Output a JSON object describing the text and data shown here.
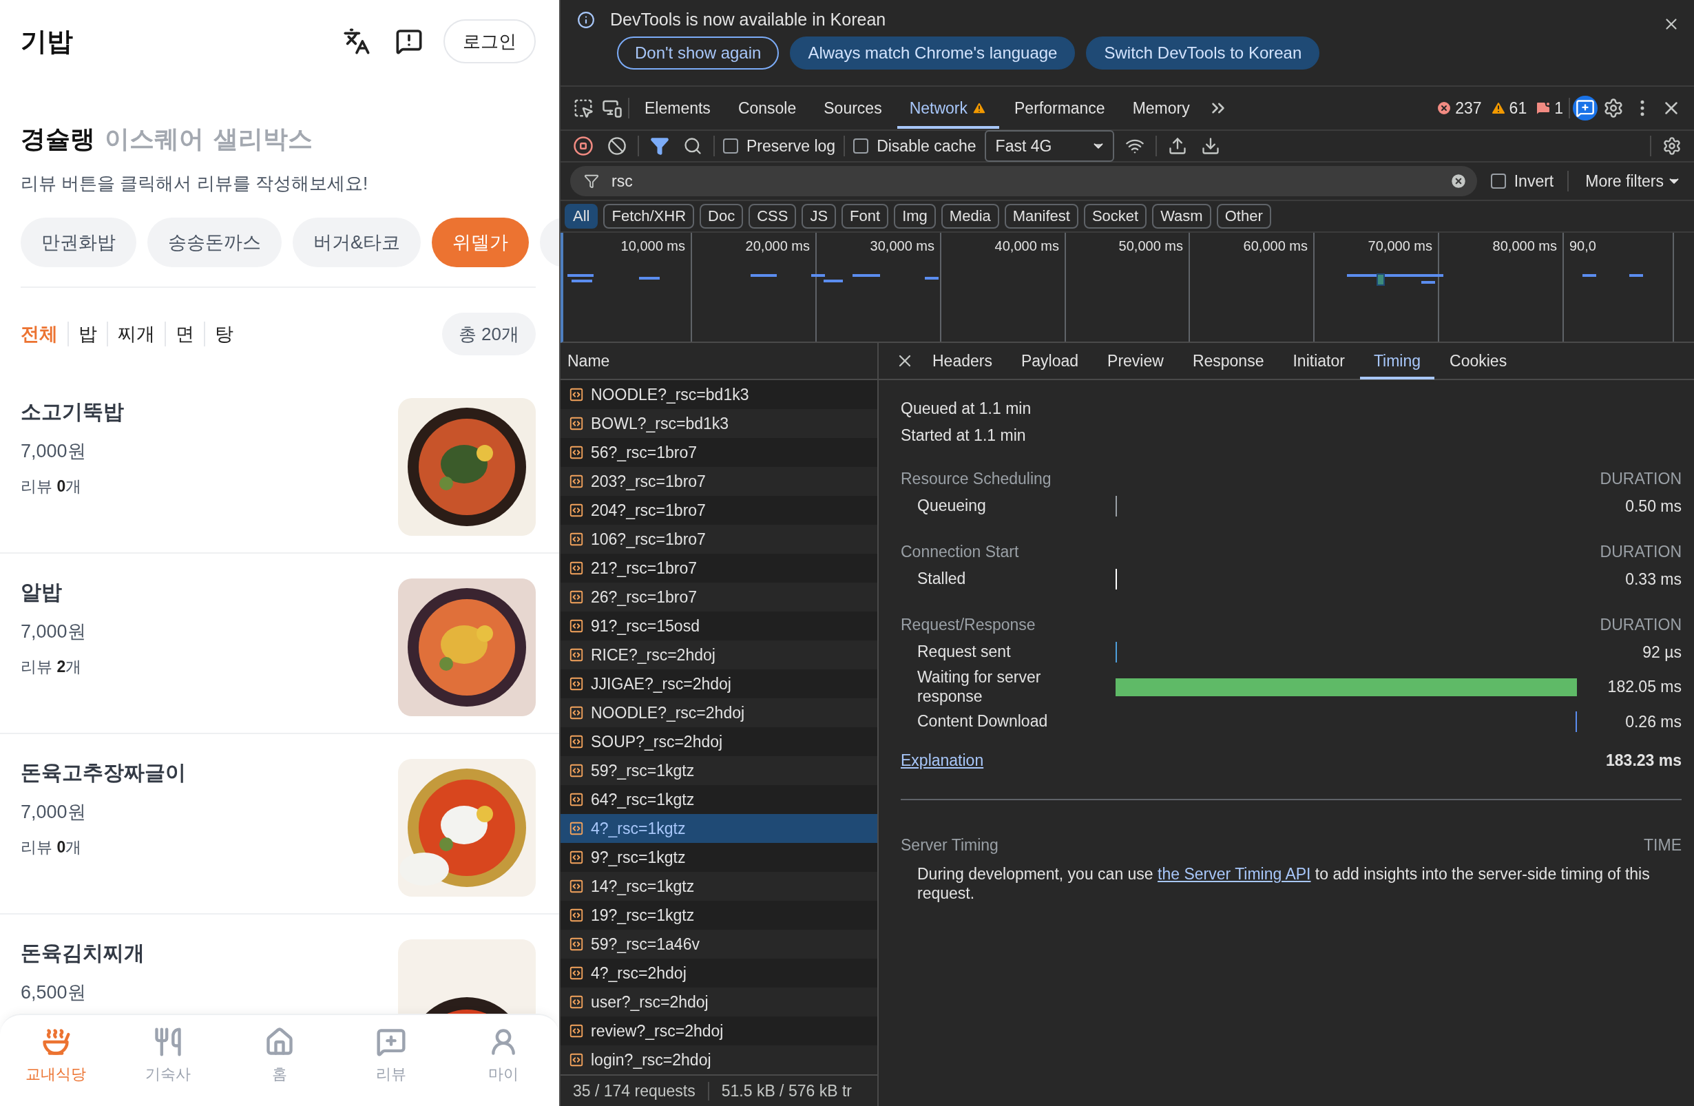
{
  "app": {
    "logo": "기밥",
    "login": "로그인",
    "title": "경슐랭",
    "title_tabs": [
      "이스퀘어",
      "샐리박스"
    ],
    "subtitle": "리뷰 버튼을 클릭해서 리뷰를 작성해보세요!",
    "chips": [
      {
        "label": "만권화밥",
        "selected": false
      },
      {
        "label": "송송돈까스",
        "selected": false
      },
      {
        "label": "버거&타코",
        "selected": false
      },
      {
        "label": "위델가",
        "selected": true
      }
    ],
    "categories": [
      {
        "label": "전체",
        "selected": true
      },
      {
        "label": "밥",
        "selected": false
      },
      {
        "label": "찌개",
        "selected": false
      },
      {
        "label": "면",
        "selected": false
      },
      {
        "label": "탕",
        "selected": false
      }
    ],
    "count": "총 20개",
    "menu": [
      {
        "name": "소고기뚝밥",
        "price": "7,000원",
        "reviews": "리뷰 **0**개"
      },
      {
        "name": "알밥",
        "price": "7,000원",
        "reviews": "리뷰 **2**개"
      },
      {
        "name": "돈육고추장짜글이",
        "price": "7,000원",
        "reviews": "리뷰 **0**개"
      },
      {
        "name": "돈육김치찌개",
        "price": "6,500원"
      }
    ],
    "nav": [
      {
        "label": "교내식당",
        "selected": true
      },
      {
        "label": "기숙사",
        "selected": false
      },
      {
        "label": "홈",
        "selected": false
      },
      {
        "label": "리뷰",
        "selected": false
      },
      {
        "label": "마이",
        "selected": false
      }
    ]
  },
  "devtools": {
    "infobar": {
      "message": "DevTools is now available in Korean",
      "buttons": [
        {
          "label": "Don't show again",
          "kind": "outline"
        },
        {
          "label": "Always match Chrome's language",
          "kind": "filled"
        },
        {
          "label": "Switch DevTools to Korean",
          "kind": "filled"
        }
      ]
    },
    "tabs": [
      {
        "label": "Elements",
        "selected": false
      },
      {
        "label": "Console",
        "selected": false
      },
      {
        "label": "Sources",
        "selected": false
      },
      {
        "label": "Network",
        "selected": true
      },
      {
        "label": "Performance",
        "selected": false
      },
      {
        "label": "Memory",
        "selected": false
      }
    ],
    "counts": {
      "errors": "237",
      "warnings": "61",
      "issues": "1"
    },
    "toolbar": {
      "preserve_log": {
        "label": "Preserve log",
        "checked": false
      },
      "disable_cache": {
        "label": "Disable cache",
        "checked": false
      },
      "throttle": "Fast 4G"
    },
    "filter": {
      "value": "rsc",
      "invert": {
        "label": "Invert",
        "checked": false
      },
      "more": "More filters"
    },
    "types": [
      {
        "label": "All",
        "selected": true
      },
      {
        "label": "Fetch/XHR",
        "selected": false
      },
      {
        "label": "Doc",
        "selected": false
      },
      {
        "label": "CSS",
        "selected": false
      },
      {
        "label": "JS",
        "selected": false
      },
      {
        "label": "Font",
        "selected": false
      },
      {
        "label": "Img",
        "selected": false
      },
      {
        "label": "Media",
        "selected": false
      },
      {
        "label": "Manifest",
        "selected": false
      },
      {
        "label": "Socket",
        "selected": false
      },
      {
        "label": "Wasm",
        "selected": false
      },
      {
        "label": "Other",
        "selected": false
      }
    ],
    "overview_ticks": [
      "10,000 ms",
      "20,000 ms",
      "30,000 ms",
      "40,000 ms",
      "50,000 ms",
      "60,000 ms",
      "70,000 ms",
      "80,000 ms",
      "90,0"
    ],
    "requests": {
      "header": "Name",
      "rows": [
        {
          "name": "NOODLE?_rsc=bd1k3",
          "selected": false
        },
        {
          "name": "BOWL?_rsc=bd1k3",
          "selected": false
        },
        {
          "name": "56?_rsc=1bro7",
          "selected": false
        },
        {
          "name": "203?_rsc=1bro7",
          "selected": false
        },
        {
          "name": "204?_rsc=1bro7",
          "selected": false
        },
        {
          "name": "106?_rsc=1bro7",
          "selected": false
        },
        {
          "name": "21?_rsc=1bro7",
          "selected": false
        },
        {
          "name": "26?_rsc=1bro7",
          "selected": false
        },
        {
          "name": "91?_rsc=15osd",
          "selected": false
        },
        {
          "name": "RICE?_rsc=2hdoj",
          "selected": false
        },
        {
          "name": "JJIGAE?_rsc=2hdoj",
          "selected": false
        },
        {
          "name": "NOODLE?_rsc=2hdoj",
          "selected": false
        },
        {
          "name": "SOUP?_rsc=2hdoj",
          "selected": false
        },
        {
          "name": "59?_rsc=1kgtz",
          "selected": false
        },
        {
          "name": "64?_rsc=1kgtz",
          "selected": false
        },
        {
          "name": "4?_rsc=1kgtz",
          "selected": true
        },
        {
          "name": "9?_rsc=1kgtz",
          "selected": false
        },
        {
          "name": "14?_rsc=1kgtz",
          "selected": false
        },
        {
          "name": "19?_rsc=1kgtz",
          "selected": false
        },
        {
          "name": "59?_rsc=1a46v",
          "selected": false
        },
        {
          "name": "4?_rsc=2hdoj",
          "selected": false
        },
        {
          "name": "user?_rsc=2hdoj",
          "selected": false
        },
        {
          "name": "review?_rsc=2hdoj",
          "selected": false
        },
        {
          "name": "login?_rsc=2hdoj",
          "selected": false
        }
      ]
    },
    "details": {
      "tabs": [
        {
          "label": "Headers",
          "selected": false
        },
        {
          "label": "Payload",
          "selected": false
        },
        {
          "label": "Preview",
          "selected": false
        },
        {
          "label": "Response",
          "selected": false
        },
        {
          "label": "Initiator",
          "selected": false
        },
        {
          "label": "Timing",
          "selected": true
        },
        {
          "label": "Cookies",
          "selected": false
        }
      ],
      "queued": "Queued at 1.1 min",
      "started": "Started at 1.1 min",
      "sections": [
        {
          "title": "Resource Scheduling",
          "column": "DURATION",
          "rows": [
            {
              "label": "Queueing",
              "value": "0.50 ms",
              "kind": "start-tick",
              "color": "#9aa0a6"
            }
          ]
        },
        {
          "title": "Connection Start",
          "column": "DURATION",
          "rows": [
            {
              "label": "Stalled",
              "value": "0.33 ms",
              "kind": "start-tick",
              "color": "#ffffff"
            }
          ]
        },
        {
          "title": "Request/Response",
          "column": "DURATION",
          "rows": [
            {
              "label": "Request sent",
              "value": "92 µs",
              "kind": "start-tick",
              "color": "#4e9fdc"
            },
            {
              "label": "Waiting for server response",
              "value": "182.05 ms",
              "kind": "bar",
              "color": "#5fba67"
            },
            {
              "label": "Content Download",
              "value": "0.26 ms",
              "kind": "end-tick",
              "color": "#5b8def"
            }
          ]
        }
      ],
      "explanation": "Explanation",
      "total": "183.23 ms",
      "server": {
        "title": "Server Timing",
        "column": "TIME",
        "before": "During development, you can use ",
        "link": "the Server Timing API",
        "after": " to add insights into the server-side timing of this request."
      }
    },
    "status": [
      "35 / 174 requests",
      "51.5 kB / 576 kB tr"
    ]
  }
}
